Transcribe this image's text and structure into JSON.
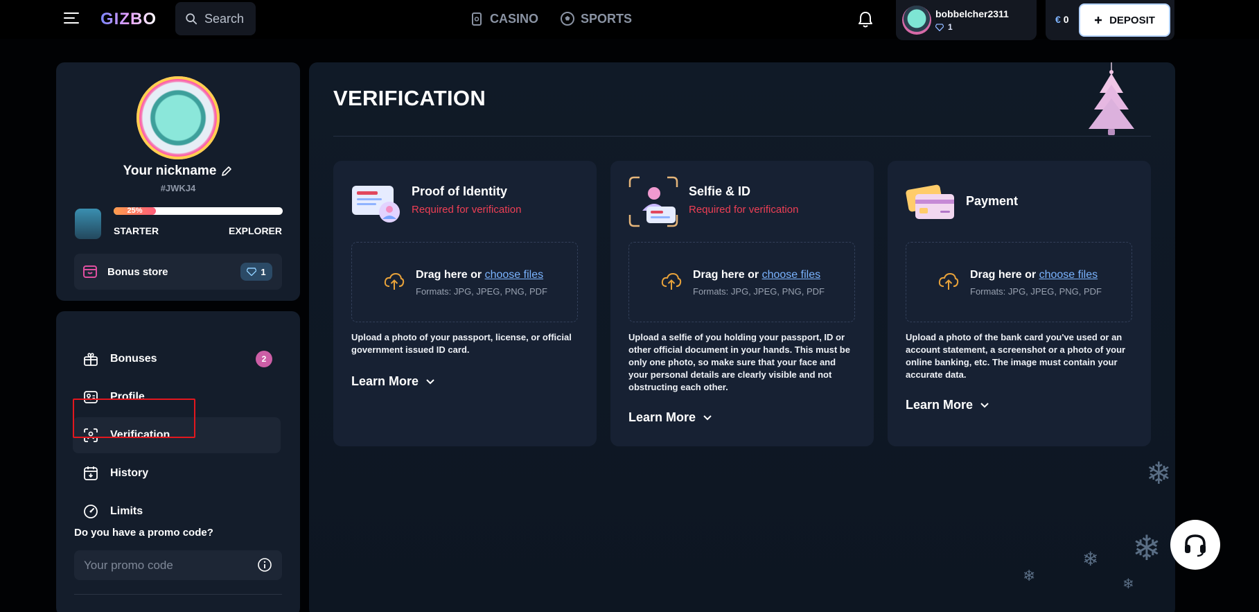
{
  "header": {
    "logo": "GIZBO",
    "search_label": "Search",
    "nav": [
      {
        "label": "CASINO"
      },
      {
        "label": "SPORTS"
      }
    ],
    "user": {
      "name": "bobbelcher2311",
      "gems": "1"
    },
    "balance": {
      "currency": "€",
      "amount": "0"
    },
    "deposit_label": "DEPOSIT"
  },
  "profile": {
    "nickname": "Your nickname",
    "user_id": "#JWKJ4",
    "progress": {
      "percent_label": "25%",
      "value": 0.25
    },
    "level_from": "STARTER",
    "level_to": "EXPLORER",
    "bonus_store": {
      "label": "Bonus store",
      "count": "1"
    }
  },
  "menu": {
    "items": [
      {
        "label": "Bonuses",
        "count": "2"
      },
      {
        "label": "Profile"
      },
      {
        "label": "Verification"
      },
      {
        "label": "History"
      },
      {
        "label": "Limits"
      }
    ],
    "promo_question": "Do you have a promo code?",
    "promo_placeholder": "Your promo code"
  },
  "main": {
    "title": "VERIFICATION",
    "cards": [
      {
        "title": "Proof of Identity",
        "status": "Required for verification",
        "drag_text": "Drag here or ",
        "choose_link": "choose files",
        "formats": "Formats: JPG, JPEG, PNG, PDF",
        "description": "Upload a photo of your passport, license, or official government issued ID card.",
        "learn_more": "Learn More"
      },
      {
        "title": "Selfie & ID",
        "status": "Required for verification",
        "drag_text": "Drag here or ",
        "choose_link": "choose files",
        "formats": "Formats: JPG, JPEG, PNG, PDF",
        "description": "Upload a selfie of you holding your passport, ID or other official document in your hands. This must be only one photo, so make sure that your face and your personal details are clearly visible and not obstructing each other.",
        "learn_more": "Learn More"
      },
      {
        "title": "Payment",
        "drag_text": "Drag here or ",
        "choose_link": "choose files",
        "formats": "Formats: JPG, JPEG, PNG, PDF",
        "description": "Upload a photo of the bank card you've used or an account statement, a screenshot or a photo of your online banking, etc. The image must contain your accurate data.",
        "learn_more": "Learn More"
      }
    ]
  },
  "colors": {
    "accent_red": "#ee3f55",
    "link_blue": "#7bb4ff",
    "highlight_red": "#e3171e",
    "badge_pink": "#cc5ea6"
  }
}
